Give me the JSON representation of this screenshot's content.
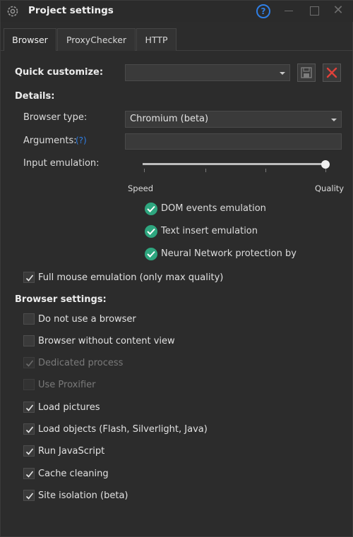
{
  "window": {
    "title": "Project settings",
    "help_label": "?",
    "close_label": "✕"
  },
  "tabs": [
    {
      "label": "Browser",
      "active": true
    },
    {
      "label": "ProxyChecker",
      "active": false
    },
    {
      "label": "HTTP",
      "active": false
    }
  ],
  "quick_customize": {
    "label": "Quick customize:",
    "value": ""
  },
  "details": {
    "heading": "Details:",
    "browser_type_label": "Browser type:",
    "browser_type_value": "Chromium (beta)",
    "arguments_label": "Arguments:",
    "arguments_help": "(?)",
    "arguments_value": "",
    "input_emulation_label": "Input emulation:",
    "slider_min_label": "Speed",
    "slider_max_label": "Quality",
    "slider_value_fraction": 1.0,
    "emulation_features": [
      "DOM events emulation",
      "Text insert emulation",
      "Neural Network protection bypas"
    ],
    "full_mouse_emulation": {
      "label": "Full mouse emulation (only max quality)",
      "checked": true
    }
  },
  "browser_settings": {
    "heading": "Browser settings:",
    "options": [
      {
        "label": "Do not use a browser",
        "checked": false,
        "enabled": true
      },
      {
        "label": "Browser without content view",
        "checked": false,
        "enabled": true
      },
      {
        "label": "Dedicated process",
        "checked": true,
        "enabled": false
      },
      {
        "label": "Use Proxifier",
        "checked": false,
        "enabled": false
      },
      {
        "label": "Load pictures",
        "checked": true,
        "enabled": true
      },
      {
        "label": "Load objects (Flash, Silverlight, Java)",
        "checked": true,
        "enabled": true
      },
      {
        "label": "Run JavaScript",
        "checked": true,
        "enabled": true
      },
      {
        "label": "Cache cleaning",
        "checked": true,
        "enabled": true
      },
      {
        "label": "Site isolation (beta)",
        "checked": true,
        "enabled": true
      }
    ]
  },
  "colors": {
    "accent_blue": "#2f7fe6",
    "check_green": "#2ea67f",
    "delete_red": "#e0413a",
    "background": "#2c2c2c"
  },
  "icons": {
    "title": "gear-icon",
    "save": "save-icon",
    "delete": "delete-x-icon",
    "feature": "check-circle-icon"
  }
}
